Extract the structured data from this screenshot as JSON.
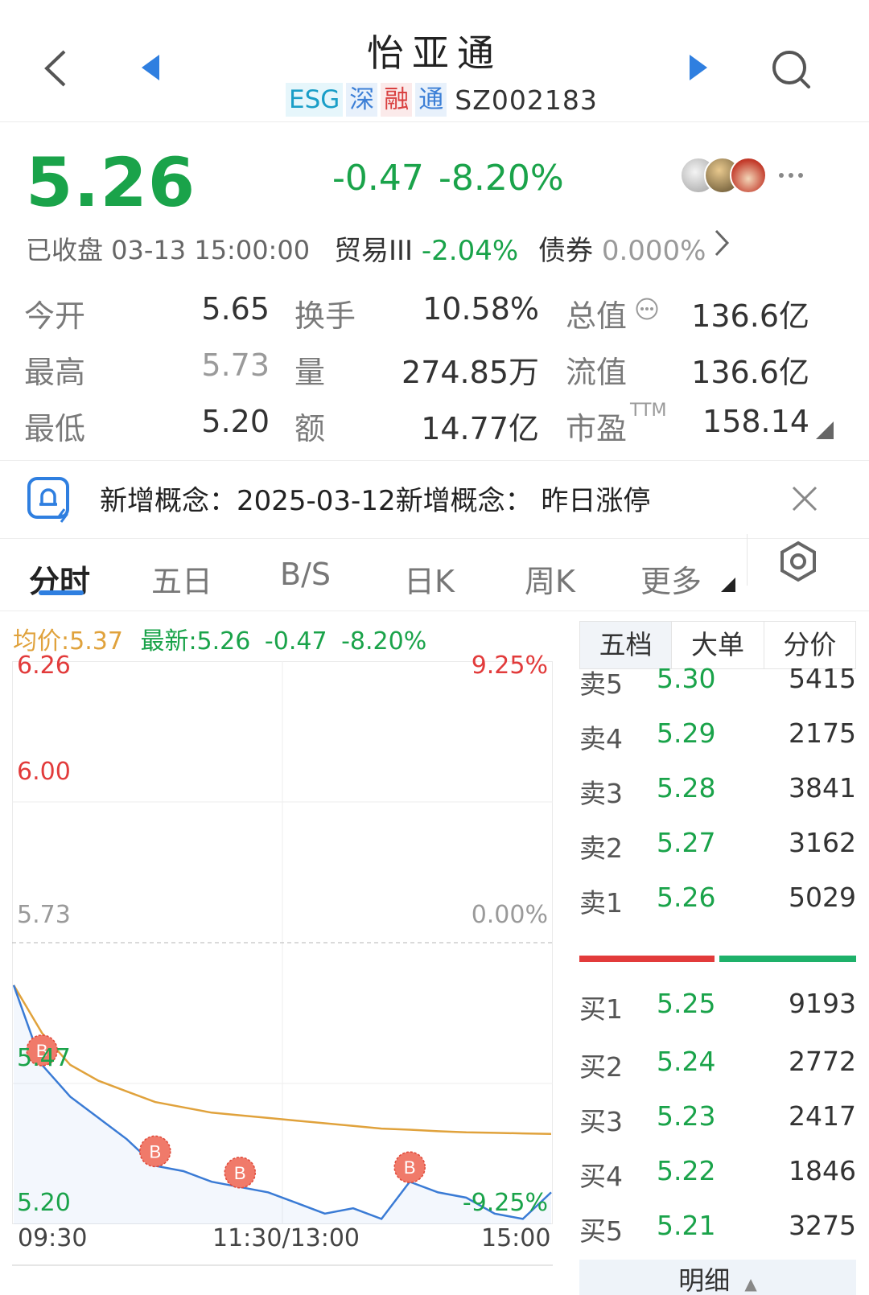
{
  "header": {
    "title": "怡亚通",
    "tags": [
      "ESG",
      "深",
      "融",
      "通"
    ],
    "code": "SZ002183"
  },
  "quote": {
    "price": "5.26",
    "change": "-0.47",
    "change_pct": "-8.20%",
    "status": "已收盘 03-13 15:00:00",
    "sector_name": "贸易III",
    "sector_pct": "-2.04%",
    "bond_name": "债券",
    "bond_pct": "0.000%"
  },
  "stats": {
    "open_label": "今开",
    "open_val": "5.65",
    "high_label": "最高",
    "high_val": "5.73",
    "low_label": "最低",
    "low_val": "5.20",
    "turnover_label": "换手",
    "turnover_val": "10.58%",
    "volume_label": "量",
    "volume_val": "274.85万",
    "amount_label": "额",
    "amount_val": "14.77亿",
    "mktcap_label": "总值",
    "mktcap_val": "136.6亿",
    "float_label": "流值",
    "float_val": "136.6亿",
    "pe_label": "市盈",
    "pe_sup": "TTM",
    "pe_val": "158.14"
  },
  "notice": {
    "text": "新增概念：2025-03-12新增概念： 昨日涨停"
  },
  "tabs": [
    "分时",
    "五日",
    "B/S",
    "日K",
    "周K",
    "更多"
  ],
  "legend": {
    "avg": "均价:5.37",
    "latest": "最新:5.26",
    "chg": "-0.47",
    "pct": "-8.20%"
  },
  "chart_labels": {
    "y_top": "6.26",
    "y_mid": "6.00",
    "y_ref": "5.73",
    "y_bottom": "5.20",
    "pct_top": "9.25%",
    "pct_ref": "0.00%",
    "pct_bottom": "-9.25%",
    "marker_price": "5.47",
    "x_start": "09:30",
    "x_mid": "11:30/13:00",
    "x_end": "15:00"
  },
  "chart_data": {
    "type": "line",
    "ylim": [
      5.2,
      6.26
    ],
    "reference_price": 5.73,
    "x_ticks": [
      "09:30",
      "11:30/13:00",
      "15:00"
    ],
    "trade_markers": [
      "B",
      "B",
      "B",
      "B"
    ],
    "series": [
      {
        "name": "均价",
        "color": "#e0a23c",
        "values": [
          5.65,
          5.56,
          5.5,
          5.47,
          5.45,
          5.43,
          5.42,
          5.41,
          5.405,
          5.4,
          5.395,
          5.39,
          5.385,
          5.38,
          5.378,
          5.375,
          5.373,
          5.372,
          5.371,
          5.37
        ]
      },
      {
        "name": "最新",
        "color": "#3a7bd5",
        "values": [
          5.65,
          5.5,
          5.44,
          5.4,
          5.36,
          5.31,
          5.3,
          5.28,
          5.27,
          5.26,
          5.24,
          5.22,
          5.23,
          5.21,
          5.28,
          5.26,
          5.25,
          5.22,
          5.21,
          5.26
        ]
      }
    ]
  },
  "order_book": {
    "tabs": [
      "五档",
      "大单",
      "分价"
    ],
    "asks": [
      {
        "label": "卖5",
        "price": "5.30",
        "vol": "5415"
      },
      {
        "label": "卖4",
        "price": "5.29",
        "vol": "2175"
      },
      {
        "label": "卖3",
        "price": "5.28",
        "vol": "3841"
      },
      {
        "label": "卖2",
        "price": "5.27",
        "vol": "3162"
      },
      {
        "label": "卖1",
        "price": "5.26",
        "vol": "5029"
      }
    ],
    "bids": [
      {
        "label": "买1",
        "price": "5.25",
        "vol": "9193"
      },
      {
        "label": "买2",
        "price": "5.24",
        "vol": "2772"
      },
      {
        "label": "买3",
        "price": "5.23",
        "vol": "2417"
      },
      {
        "label": "买4",
        "price": "5.22",
        "vol": "1846"
      },
      {
        "label": "买5",
        "price": "5.21",
        "vol": "3275"
      }
    ],
    "detail_label": "明细"
  },
  "colors": {
    "down": "#1aa34a",
    "up": "#e23b3b",
    "price_line": "#3a7bd5",
    "avg_line": "#e0a23c"
  }
}
